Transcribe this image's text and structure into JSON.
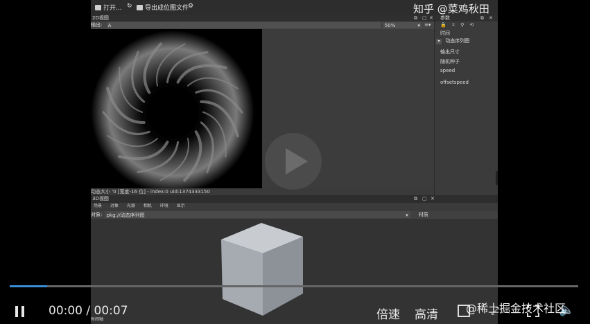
{
  "watermark": {
    "top_text": "知乎 @菜鸡秋田",
    "bottom_text": "@稀土掘金技术社区"
  },
  "toolbar": {
    "open_label": "打开...",
    "export_label": "导出成位图文件"
  },
  "view2d": {
    "title": "2D视图",
    "output_label": "输出:",
    "output_value": "A",
    "zoom_value": "50%",
    "status_text": "动态大小 '0 [宽度-16 位] - index:0 uid:1374333150"
  },
  "inspector": {
    "title": "参数",
    "time_label": "时间",
    "group_label": "动态序列图",
    "props": [
      "输出尺寸",
      "随机种子",
      "speed",
      "offsetspeed"
    ]
  },
  "view3d": {
    "title": "3D视图",
    "menu": [
      "场景",
      "对象",
      "光源",
      "相机",
      "环境",
      "显示"
    ],
    "object_label": "对象:",
    "object_value": "pkg://动态序列图",
    "material_label": "材质",
    "bottom_tab": "时间轴"
  },
  "player": {
    "time_current": "00:00",
    "time_total": "00:07",
    "speed_label": "倍速",
    "quality_label": "高清",
    "progress_fraction": 0.066
  },
  "colors": {
    "progress": "#3a8ed8",
    "cube_top": "#c8cbd0",
    "cube_left": "#a6aab1",
    "cube_right": "#8d9198"
  }
}
